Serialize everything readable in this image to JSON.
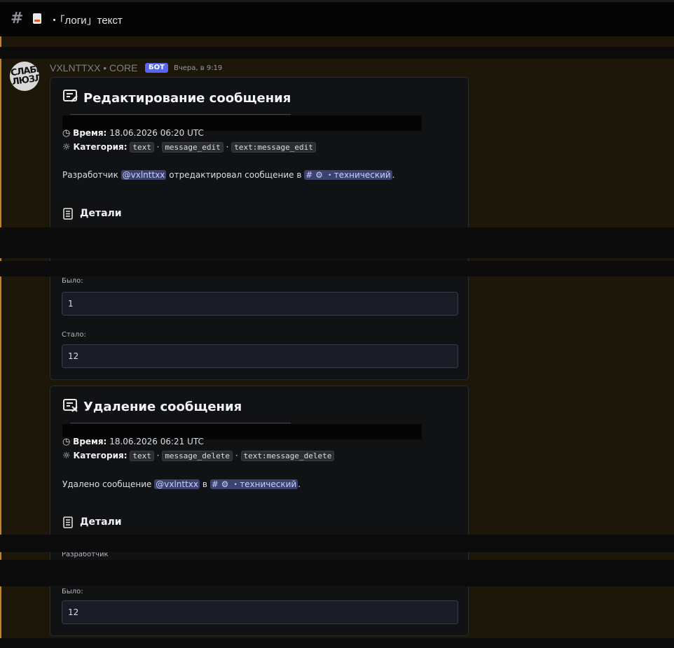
{
  "channel": {
    "title": "・「логи」текст"
  },
  "message": {
    "author": "VXLNTTXX • CORE",
    "bot_badge": "БОТ",
    "timestamp": "Вчера, в 9:19",
    "avatar_text": "СЛАБЫМ ЛЮЗЛЭ"
  },
  "embeds": [
    {
      "title": "Редактирование сообщения",
      "time_label": "Время:",
      "time_value": "18.06.2026 06:20 UTC",
      "category_label": "Категория:",
      "category_tags": [
        "text",
        "message_edit",
        "text:message_edit"
      ],
      "sep": "·",
      "desc_prefix": "Разработчик",
      "desc_mention": "@vxlnttxx",
      "desc_middle": "отредактировал сообщение в",
      "desc_channel": "# ⚙ ・технический",
      "desc_suffix": ".",
      "details_title": "Детали",
      "was_label": "Было:",
      "was_value": "1",
      "now_label": "Стало:",
      "now_value": "12"
    },
    {
      "title": "Удаление сообщения",
      "time_label": "Время:",
      "time_value": "18.06.2026 06:21 UTC",
      "category_label": "Категория:",
      "category_tags": [
        "text",
        "message_delete",
        "text:message_delete"
      ],
      "sep": "·",
      "desc_prefix": "Удалено сообщение",
      "desc_mention": "@vxlnttxx",
      "desc_middle": "в",
      "desc_channel": "# ⚙ ・технический",
      "desc_suffix": ".",
      "details_title": "Детали",
      "dev_label": "Разработчик",
      "was_label": "Было:",
      "was_value": "12"
    }
  ]
}
